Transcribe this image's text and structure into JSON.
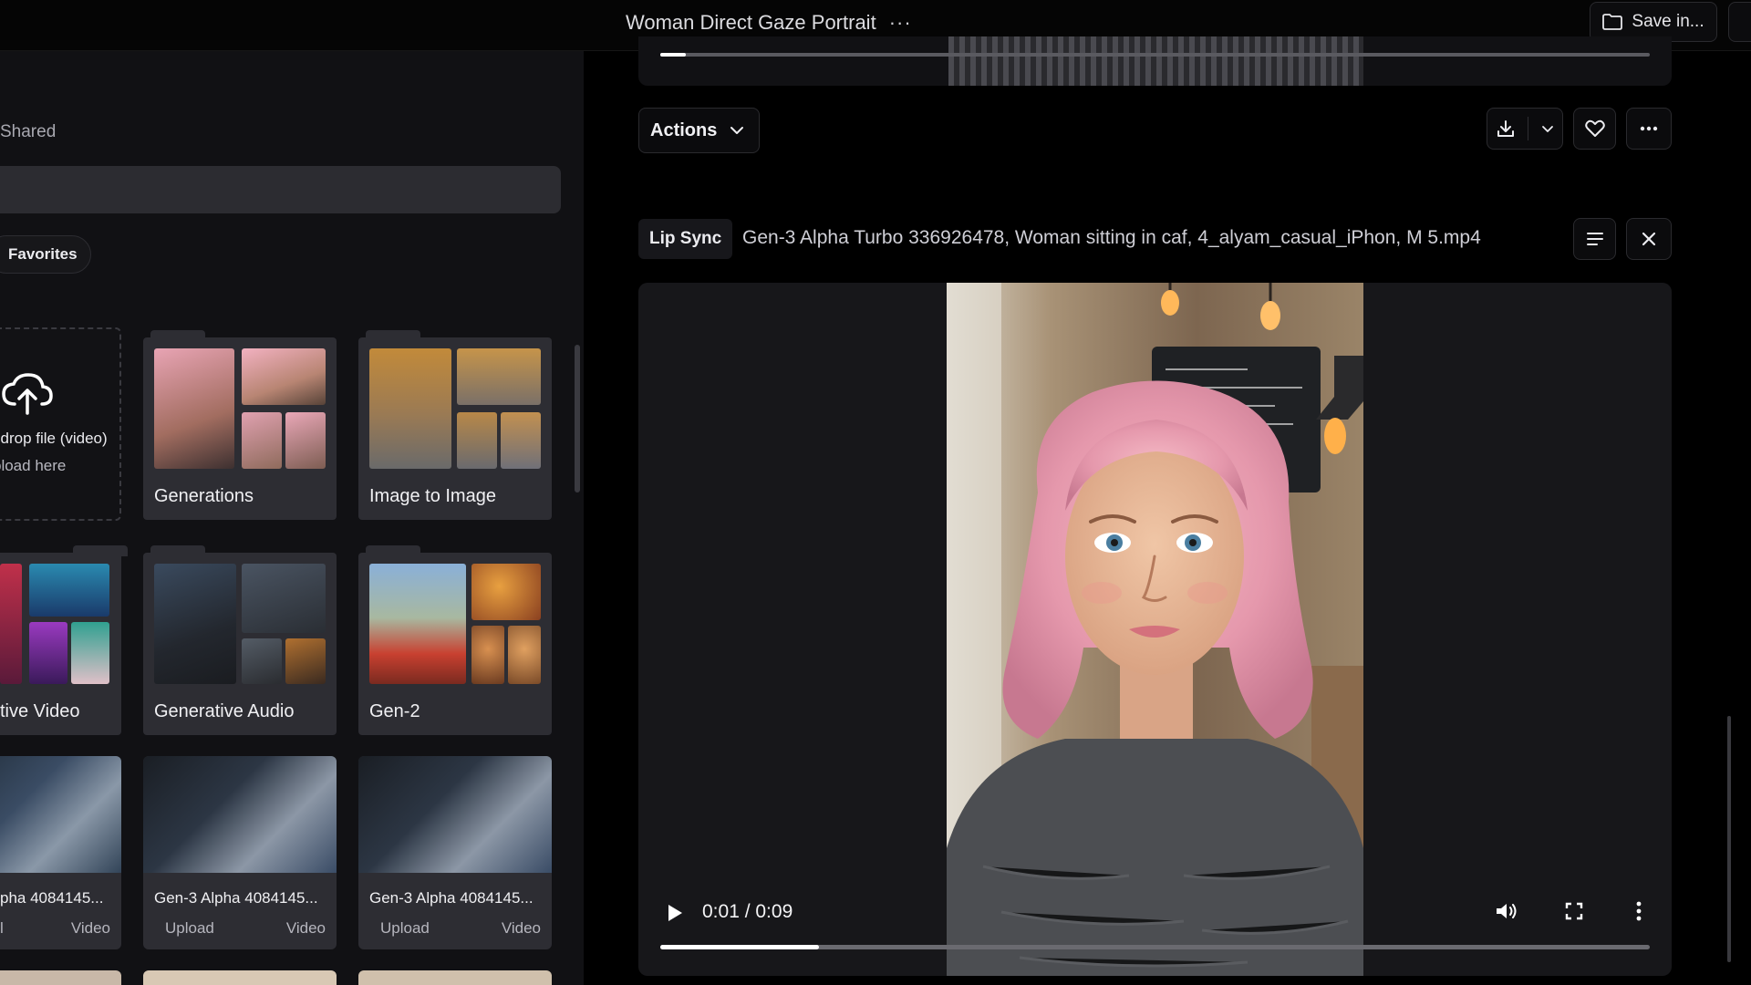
{
  "header": {
    "title": "Woman Direct Gaze Portrait",
    "more_label": "···",
    "save_label": "Save in..."
  },
  "sidebar": {
    "shared_label": "Shared",
    "favorites_label": "Favorites",
    "upload": {
      "line1": "l drop file (video)",
      "line2": "pload here"
    },
    "folders": [
      {
        "label": "Generations"
      },
      {
        "label": "Image to Image"
      },
      {
        "label": "tive Video"
      },
      {
        "label": "Generative Audio"
      },
      {
        "label": "Gen-2"
      }
    ],
    "media": [
      {
        "title": "pha 4084145...",
        "source": "l",
        "type": "Video"
      },
      {
        "title": "Gen-3 Alpha 4084145...",
        "source": "Upload",
        "type": "Video"
      },
      {
        "title": "Gen-3 Alpha 4084145...",
        "source": "Upload",
        "type": "Video"
      }
    ]
  },
  "toolbar": {
    "actions_label": "Actions"
  },
  "asset": {
    "badge": "Lip Sync",
    "file_name": "Gen-3 Alpha Turbo 336926478, Woman sitting in caf, 4_alyam_casual_iPhon, M 5.mp4"
  },
  "player": {
    "time": "0:01 / 0:09",
    "progress": 0.16
  },
  "prev_player": {
    "progress": 0.026
  },
  "icons": {
    "folder": "folder-icon",
    "upload": "upload-cloud-icon",
    "download": "download-icon",
    "chevron": "chevron-down-icon",
    "favorite": "heart-icon",
    "more": "more-horizontal-icon",
    "details": "menu-lines-icon",
    "close": "close-icon",
    "play": "play-icon",
    "volume": "volume-icon",
    "fullscreen": "fullscreen-icon",
    "kebab": "more-vertical-icon"
  },
  "colors": {
    "background": "#000000",
    "panel": "#111114",
    "tile": "#2d2d33",
    "accent_text": "#f0f0f3"
  }
}
